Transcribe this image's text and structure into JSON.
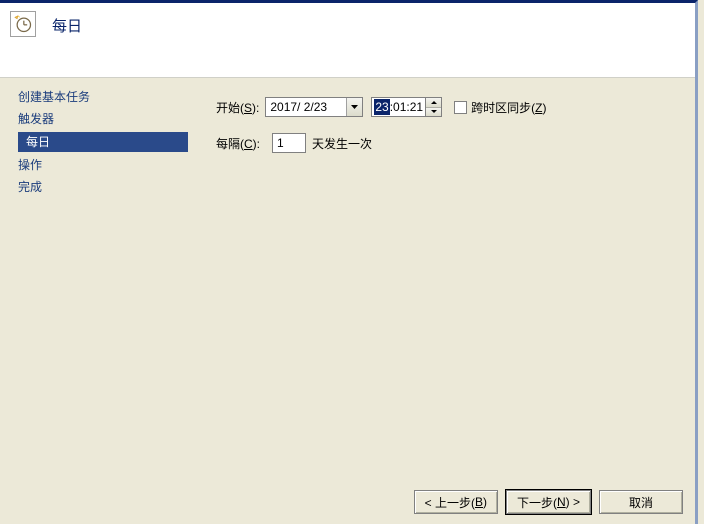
{
  "header": {
    "title": "每日"
  },
  "sidebar": {
    "items": [
      {
        "label": "创建基本任务"
      },
      {
        "label": "触发器"
      },
      {
        "label": "每日"
      },
      {
        "label": "操作"
      },
      {
        "label": "完成"
      }
    ]
  },
  "content": {
    "start_label_pre": "开始(",
    "start_label_hot": "S",
    "start_label_post": "):",
    "date_value": "2017/ 2/23",
    "time_hh": "23",
    "time_rest": ":01:21",
    "tz_label_pre": "跨时区同步(",
    "tz_label_hot": "Z",
    "tz_label_post": ")",
    "every_label_pre": "每隔(",
    "every_label_hot": "C",
    "every_label_post": "):",
    "every_value": "1",
    "every_suffix": "天发生一次"
  },
  "footer": {
    "back_pre": "< 上一步(",
    "back_hot": "B",
    "back_post": ")",
    "next_pre": "下一步(",
    "next_hot": "N",
    "next_post": ") >",
    "cancel": "取消"
  }
}
